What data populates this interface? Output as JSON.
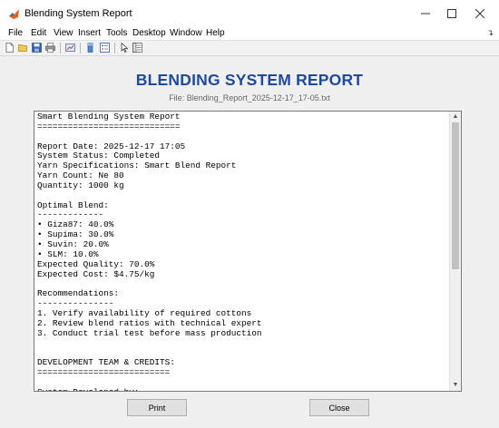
{
  "window": {
    "title": "Blending System Report",
    "icon": "matlab-icon",
    "controls": [
      "minimize-icon",
      "maximize-icon",
      "close-icon"
    ]
  },
  "menu": {
    "items": [
      "File",
      "Edit",
      "View",
      "Insert",
      "Tools",
      "Desktop",
      "Window",
      "Help"
    ]
  },
  "toolbar": {
    "icons": [
      "new-figure-icon",
      "open-file-icon",
      "save-icon",
      "print-icon",
      "link-plot-icon",
      "colorbar-icon",
      "legend-icon",
      "pointer-icon",
      "property-editor-icon"
    ]
  },
  "report": {
    "heading": "BLENDING SYSTEM REPORT",
    "file_label": "File: Blending_Report_2025-12-17_17-05.txt",
    "text": "Smart Blending System Report\n============================\n\nReport Date: 2025-12-17 17:05\nSystem Status: Completed\nYarn Specifications: Smart Blend Report\nYarn Count: Ne 80\nQuantity: 1000 kg\n\nOptimal Blend:\n-------------\n• Giza87: 40.0%\n• Supima: 30.0%\n• Suvin: 20.0%\n• SLM: 10.0%\nExpected Quality: 70.0%\nExpected Cost: $4.75/kg\n\nRecommendations:\n---------------\n1. Verify availability of required cottons\n2. Review blend ratios with technical expert\n3. Conduct trial test before mass production\n\n\nDEVELOPMENT TEAM & CREDITS:\n==========================\n\nSystem Developed by:"
  },
  "buttons": {
    "print": "Print",
    "close": "Close"
  },
  "colors": {
    "heading": "#1f4aa0",
    "figure_background": "#f0f0f0"
  }
}
